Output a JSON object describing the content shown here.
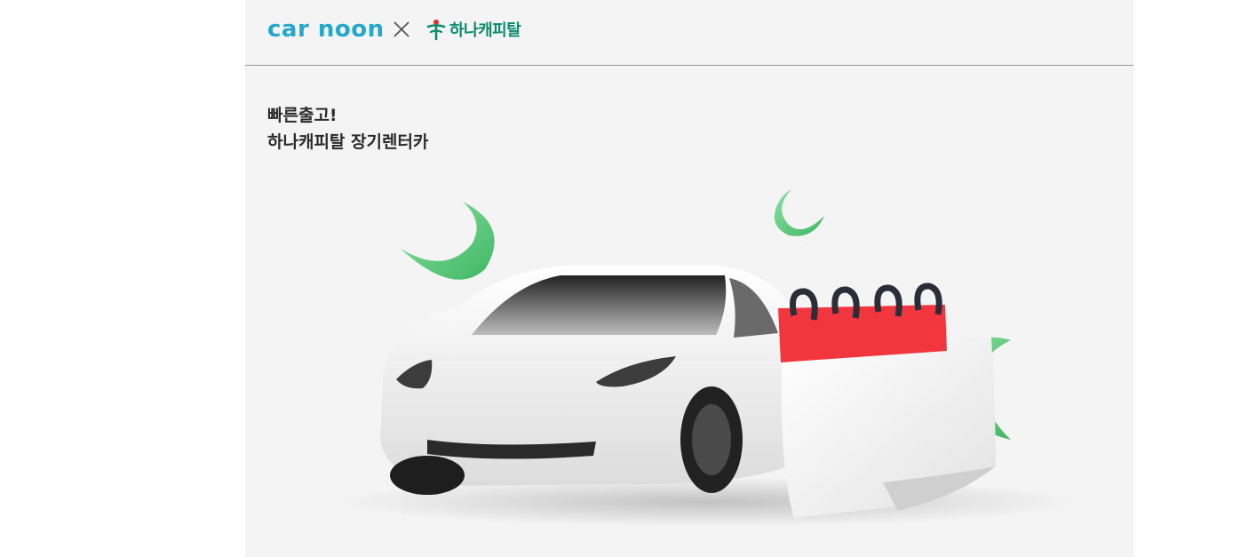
{
  "header": {
    "brand_logo_text": "car noon",
    "separator": "×",
    "partner_logo_text": "하나캐피탈"
  },
  "main": {
    "headline_line1": "빠른출고!",
    "headline_line2": "하나캐피탈 장기렌터카"
  },
  "colors": {
    "page_background": "#f4f4f4",
    "brand_cyan": "#23a8cc",
    "partner_green": "#0b8b6f",
    "leaf_green": "#5cc97a",
    "calendar_red": "#f2363f",
    "header_rule": "#9a9a9a"
  },
  "icons": {
    "separator_icon": "close-x-icon",
    "partner_symbol": "hana-symbol-icon"
  }
}
